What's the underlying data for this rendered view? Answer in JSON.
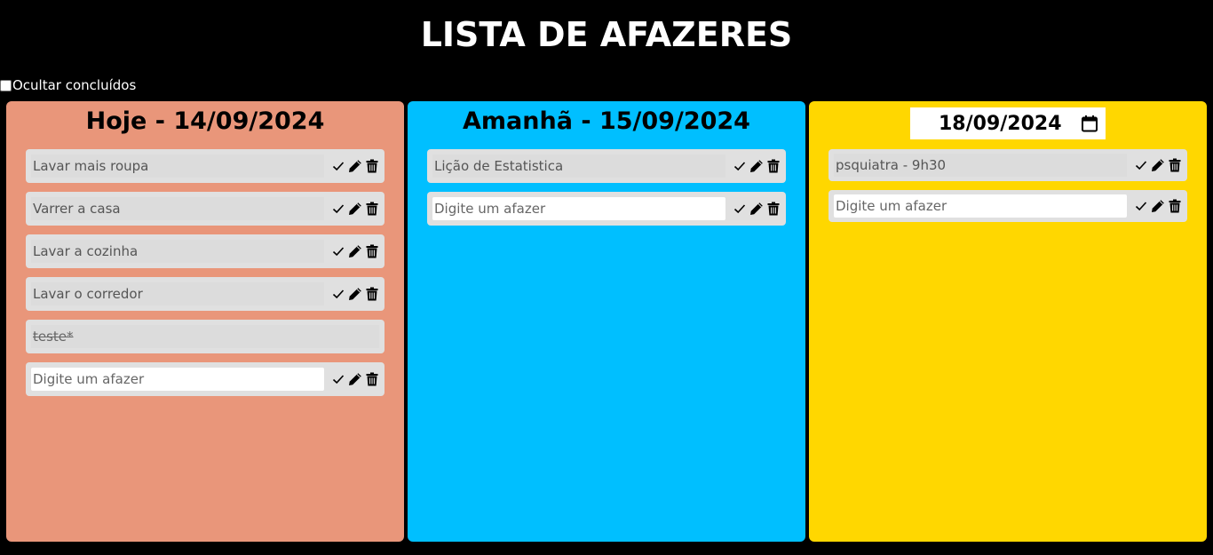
{
  "app": {
    "title": "LISTA DE AFAZERES"
  },
  "filters": {
    "hide_completed_label": "Ocultar concluídos",
    "hide_completed_checked": false
  },
  "colors": {
    "today": "#e9967a",
    "tomorrow": "#00bfff",
    "custom": "#ffd700"
  },
  "columns": {
    "today": {
      "title": "Hoje - 14/09/2024",
      "tasks": [
        {
          "text": "Lavar mais roupa",
          "done": false
        },
        {
          "text": "Varrer a casa",
          "done": false
        },
        {
          "text": "Lavar a cozinha",
          "done": false
        },
        {
          "text": "Lavar o corredor",
          "done": false
        },
        {
          "text": "teste*",
          "done": true
        }
      ],
      "new_task_placeholder": "Digite um afazer"
    },
    "tomorrow": {
      "title": "Amanhã - 15/09/2024",
      "tasks": [
        {
          "text": "Lição de Estatistica",
          "done": false
        }
      ],
      "new_task_placeholder": "Digite um afazer"
    },
    "custom": {
      "date_value": "18/09/2024",
      "tasks": [
        {
          "text": "psquiatra - 9h30",
          "done": false
        }
      ],
      "new_task_placeholder": "Digite um afazer"
    }
  },
  "icons": {
    "complete": "check-icon",
    "edit": "pencil-icon",
    "delete": "trash-icon",
    "date": "calendar-icon"
  }
}
